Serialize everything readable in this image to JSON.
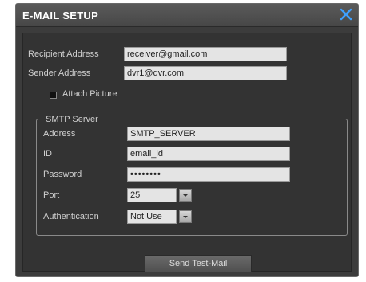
{
  "window": {
    "title": "E-MAIL SETUP",
    "close_icon": "close-x-icon",
    "accent_color": "#3ea0ff"
  },
  "recipient": {
    "label": "Recipient Address",
    "value": "receiver@gmail.com"
  },
  "sender": {
    "label": "Sender Address",
    "value": "dvr1@dvr.com"
  },
  "attach_picture": {
    "label": "Attach Picture",
    "checked": true
  },
  "smtp": {
    "group_label": "SMTP Server",
    "address": {
      "label": "Address",
      "value": "SMTP_SERVER"
    },
    "id": {
      "label": "ID",
      "value": "email_id"
    },
    "password": {
      "label": "Password",
      "value": "••••••••"
    },
    "port": {
      "label": "Port",
      "value": "25"
    },
    "authentication": {
      "label": "Authentication",
      "value": "Not Use"
    }
  },
  "send_test_mail": {
    "label": "Send Test-Mail"
  }
}
